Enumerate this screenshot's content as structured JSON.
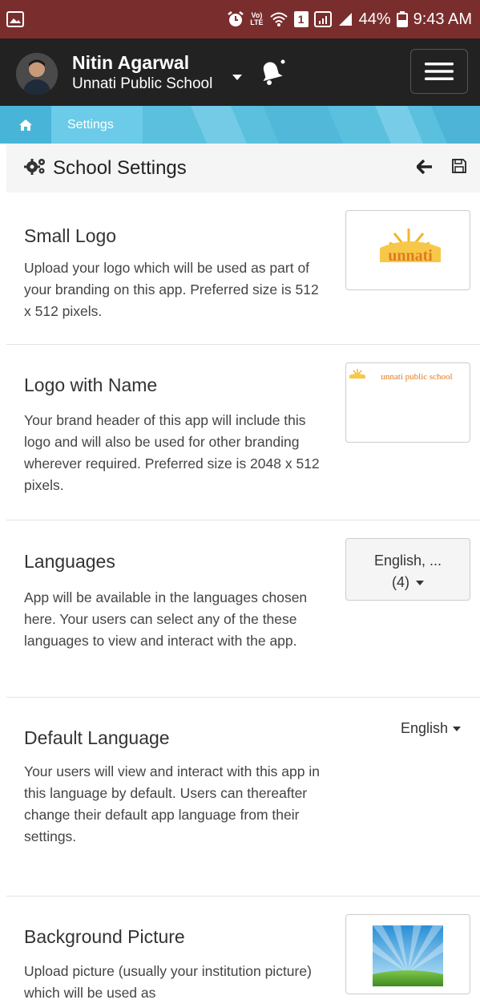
{
  "status_bar": {
    "lte_top": "Vo)",
    "lte_bottom": "LTE",
    "sim_badge": "1",
    "battery": "44%",
    "time": "9:43 AM"
  },
  "header": {
    "user_name": "Nitin Agarwal",
    "school_name": "Unnati Public School"
  },
  "breadcrumb": {
    "current": "Settings"
  },
  "page": {
    "title": "School Settings"
  },
  "settings": [
    {
      "title": "Small Logo",
      "description": "Upload your logo which will be used as part of your branding on this app. Preferred size is 512 x 512 pixels.",
      "logo_text": "unnati"
    },
    {
      "title": "Logo with Name",
      "description": "Your brand header of this app will include this logo and will also be used for other branding wherever required. Preferred size is 2048 x 512 pixels.",
      "logo_text": "unnati public school"
    },
    {
      "title": "Languages",
      "description": "App will be available in the languages chosen here. Your users can select any of the these languages to view and interact with the app.",
      "select_line1": "English, ...",
      "select_line2": "(4)"
    },
    {
      "title": "Default Language",
      "description": "Your users will view and interact with this app in this language by default. Users can thereafter change their default app language from their settings.",
      "value": "English"
    },
    {
      "title": "Background Picture",
      "description": "Upload picture (usually your institution picture) which will be used as"
    }
  ],
  "colors": {
    "status_bar": "#7a2d2d",
    "app_bar": "#222222",
    "breadcrumb": "#5bc0de",
    "logo_orange": "#e07b1e"
  }
}
